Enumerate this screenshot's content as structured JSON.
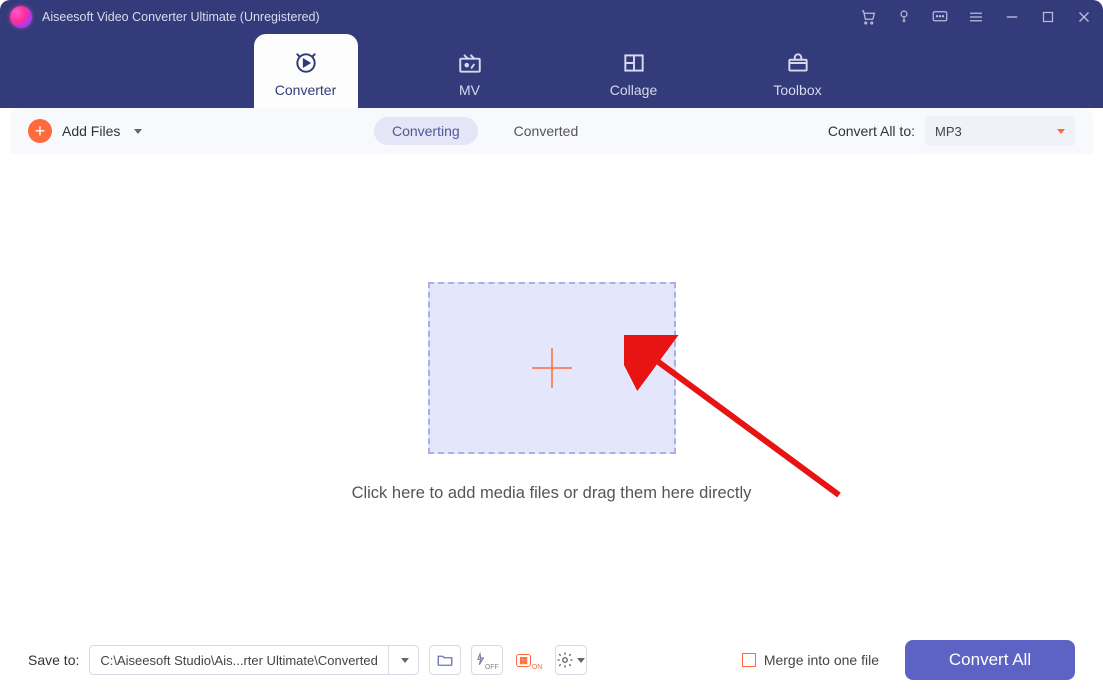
{
  "window": {
    "title": "Aiseesoft Video Converter Ultimate (Unregistered)"
  },
  "nav": {
    "converter": "Converter",
    "mv": "MV",
    "collage": "Collage",
    "toolbox": "Toolbox"
  },
  "toolbar": {
    "add_files": "Add Files",
    "seg_converting": "Converting",
    "seg_converted": "Converted",
    "convert_all_to": "Convert All to:",
    "format": "MP3"
  },
  "drop": {
    "message": "Click here to add media files or drag them here directly"
  },
  "bottom": {
    "save_to_label": "Save to:",
    "save_path": "C:\\Aiseesoft Studio\\Ais...rter Ultimate\\Converted",
    "merge_label": "Merge into one file",
    "convert_all": "Convert All"
  }
}
